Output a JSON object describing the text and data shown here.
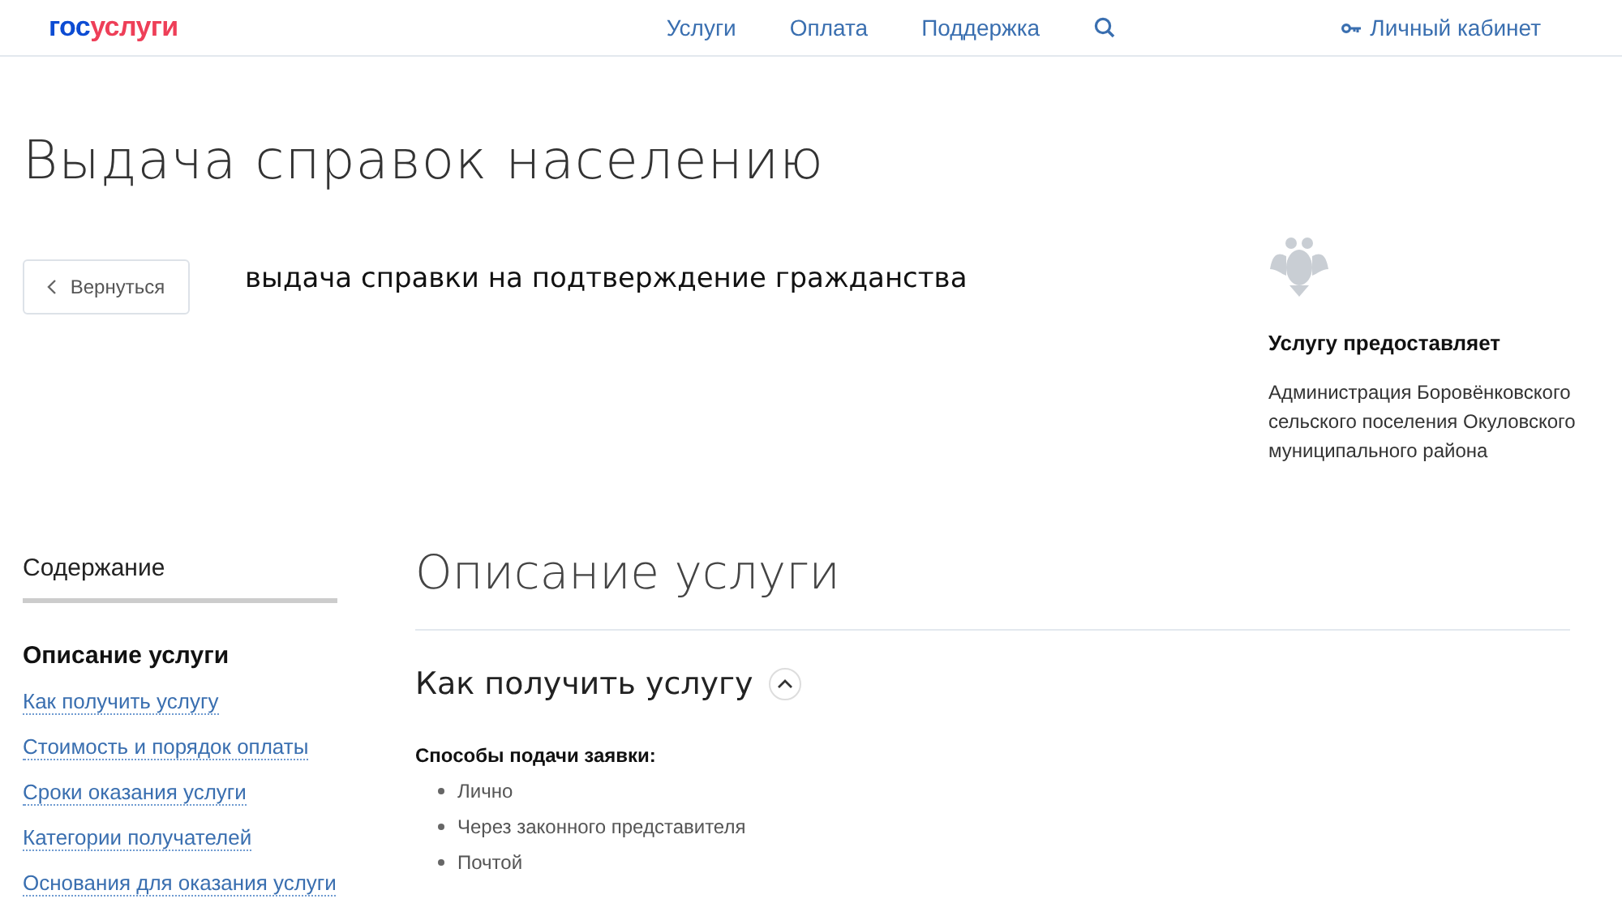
{
  "header": {
    "logo": [
      "гос",
      "услуги"
    ],
    "nav": [
      "Услуги",
      "Оплата",
      "Поддержка"
    ],
    "account": "Личный кабинет"
  },
  "title": "Выдача справок населению",
  "back_button": "Вернуться",
  "service_name": "выдача справки на подтверждение гражданства",
  "provider": {
    "heading": "Услугу предоставляет",
    "name": "Администрация Боровёнковского сельского поселения Окуловского муниципального района"
  },
  "toc": {
    "title": "Содержание",
    "items": [
      {
        "label": "Описание услуги",
        "selected": true
      },
      {
        "label": "Как получить услугу",
        "selected": false
      },
      {
        "label": "Стоимость и порядок оплаты",
        "selected": false
      },
      {
        "label": "Сроки оказания услуги",
        "selected": false
      },
      {
        "label": "Категории получателей",
        "selected": false
      },
      {
        "label": "Основания для оказания услуги",
        "selected": false
      }
    ]
  },
  "section": {
    "title": "Описание услуги",
    "subsection": {
      "title": "Как получить услугу",
      "expanded": true,
      "label": "Способы подачи заявки:",
      "methods": [
        "Лично",
        "Через законного представителя",
        "Почтой"
      ]
    }
  }
}
